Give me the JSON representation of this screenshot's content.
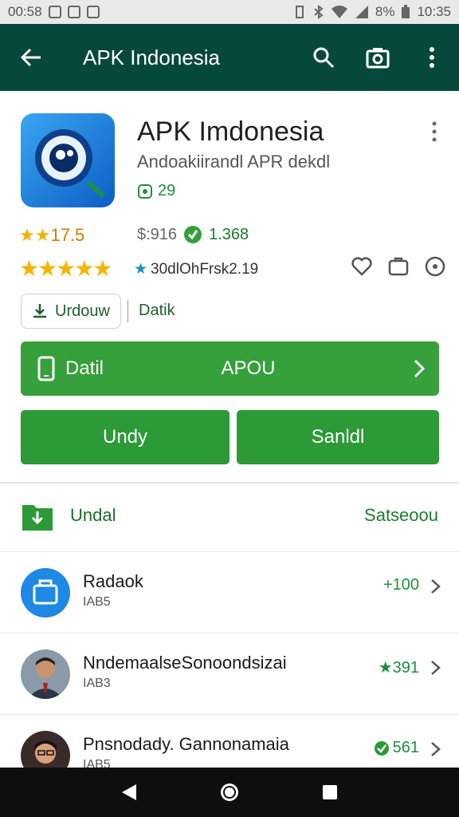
{
  "status_bar": {
    "time": "00:58",
    "battery": "8%",
    "clock": "10:35"
  },
  "app_bar": {
    "title": "APK Indonesia"
  },
  "app": {
    "name": "APK Imdonesia",
    "subtitle": "Andoakiirandl APR dekdl",
    "size": "29",
    "rating_value": "17.5",
    "price": "$:916",
    "downloads": "1.368",
    "review_text": "30dlOhFrsk2.19",
    "stars": "★★★★★"
  },
  "chip": {
    "label": "Urdouw"
  },
  "detail_link": "Datik",
  "wide_button": {
    "left_label": "Datil",
    "center_label": "APOU"
  },
  "buttons": {
    "left": "Undy",
    "right": "Sanldl"
  },
  "section": {
    "title": "Undal",
    "link": "Satseoou"
  },
  "list": [
    {
      "name": "Radaok",
      "sub": "IAB5",
      "value": "+100"
    },
    {
      "name": "NndemaalseSonoondsizai",
      "sub": "IAB3",
      "value": "★391"
    },
    {
      "name": "Pnsnodady. Gannonamaia",
      "sub": "IAB5",
      "value": "561"
    }
  ],
  "colors": {
    "app_bar": "#07483d",
    "accent_green": "#36a03a",
    "text_green": "#1e7a2f"
  }
}
